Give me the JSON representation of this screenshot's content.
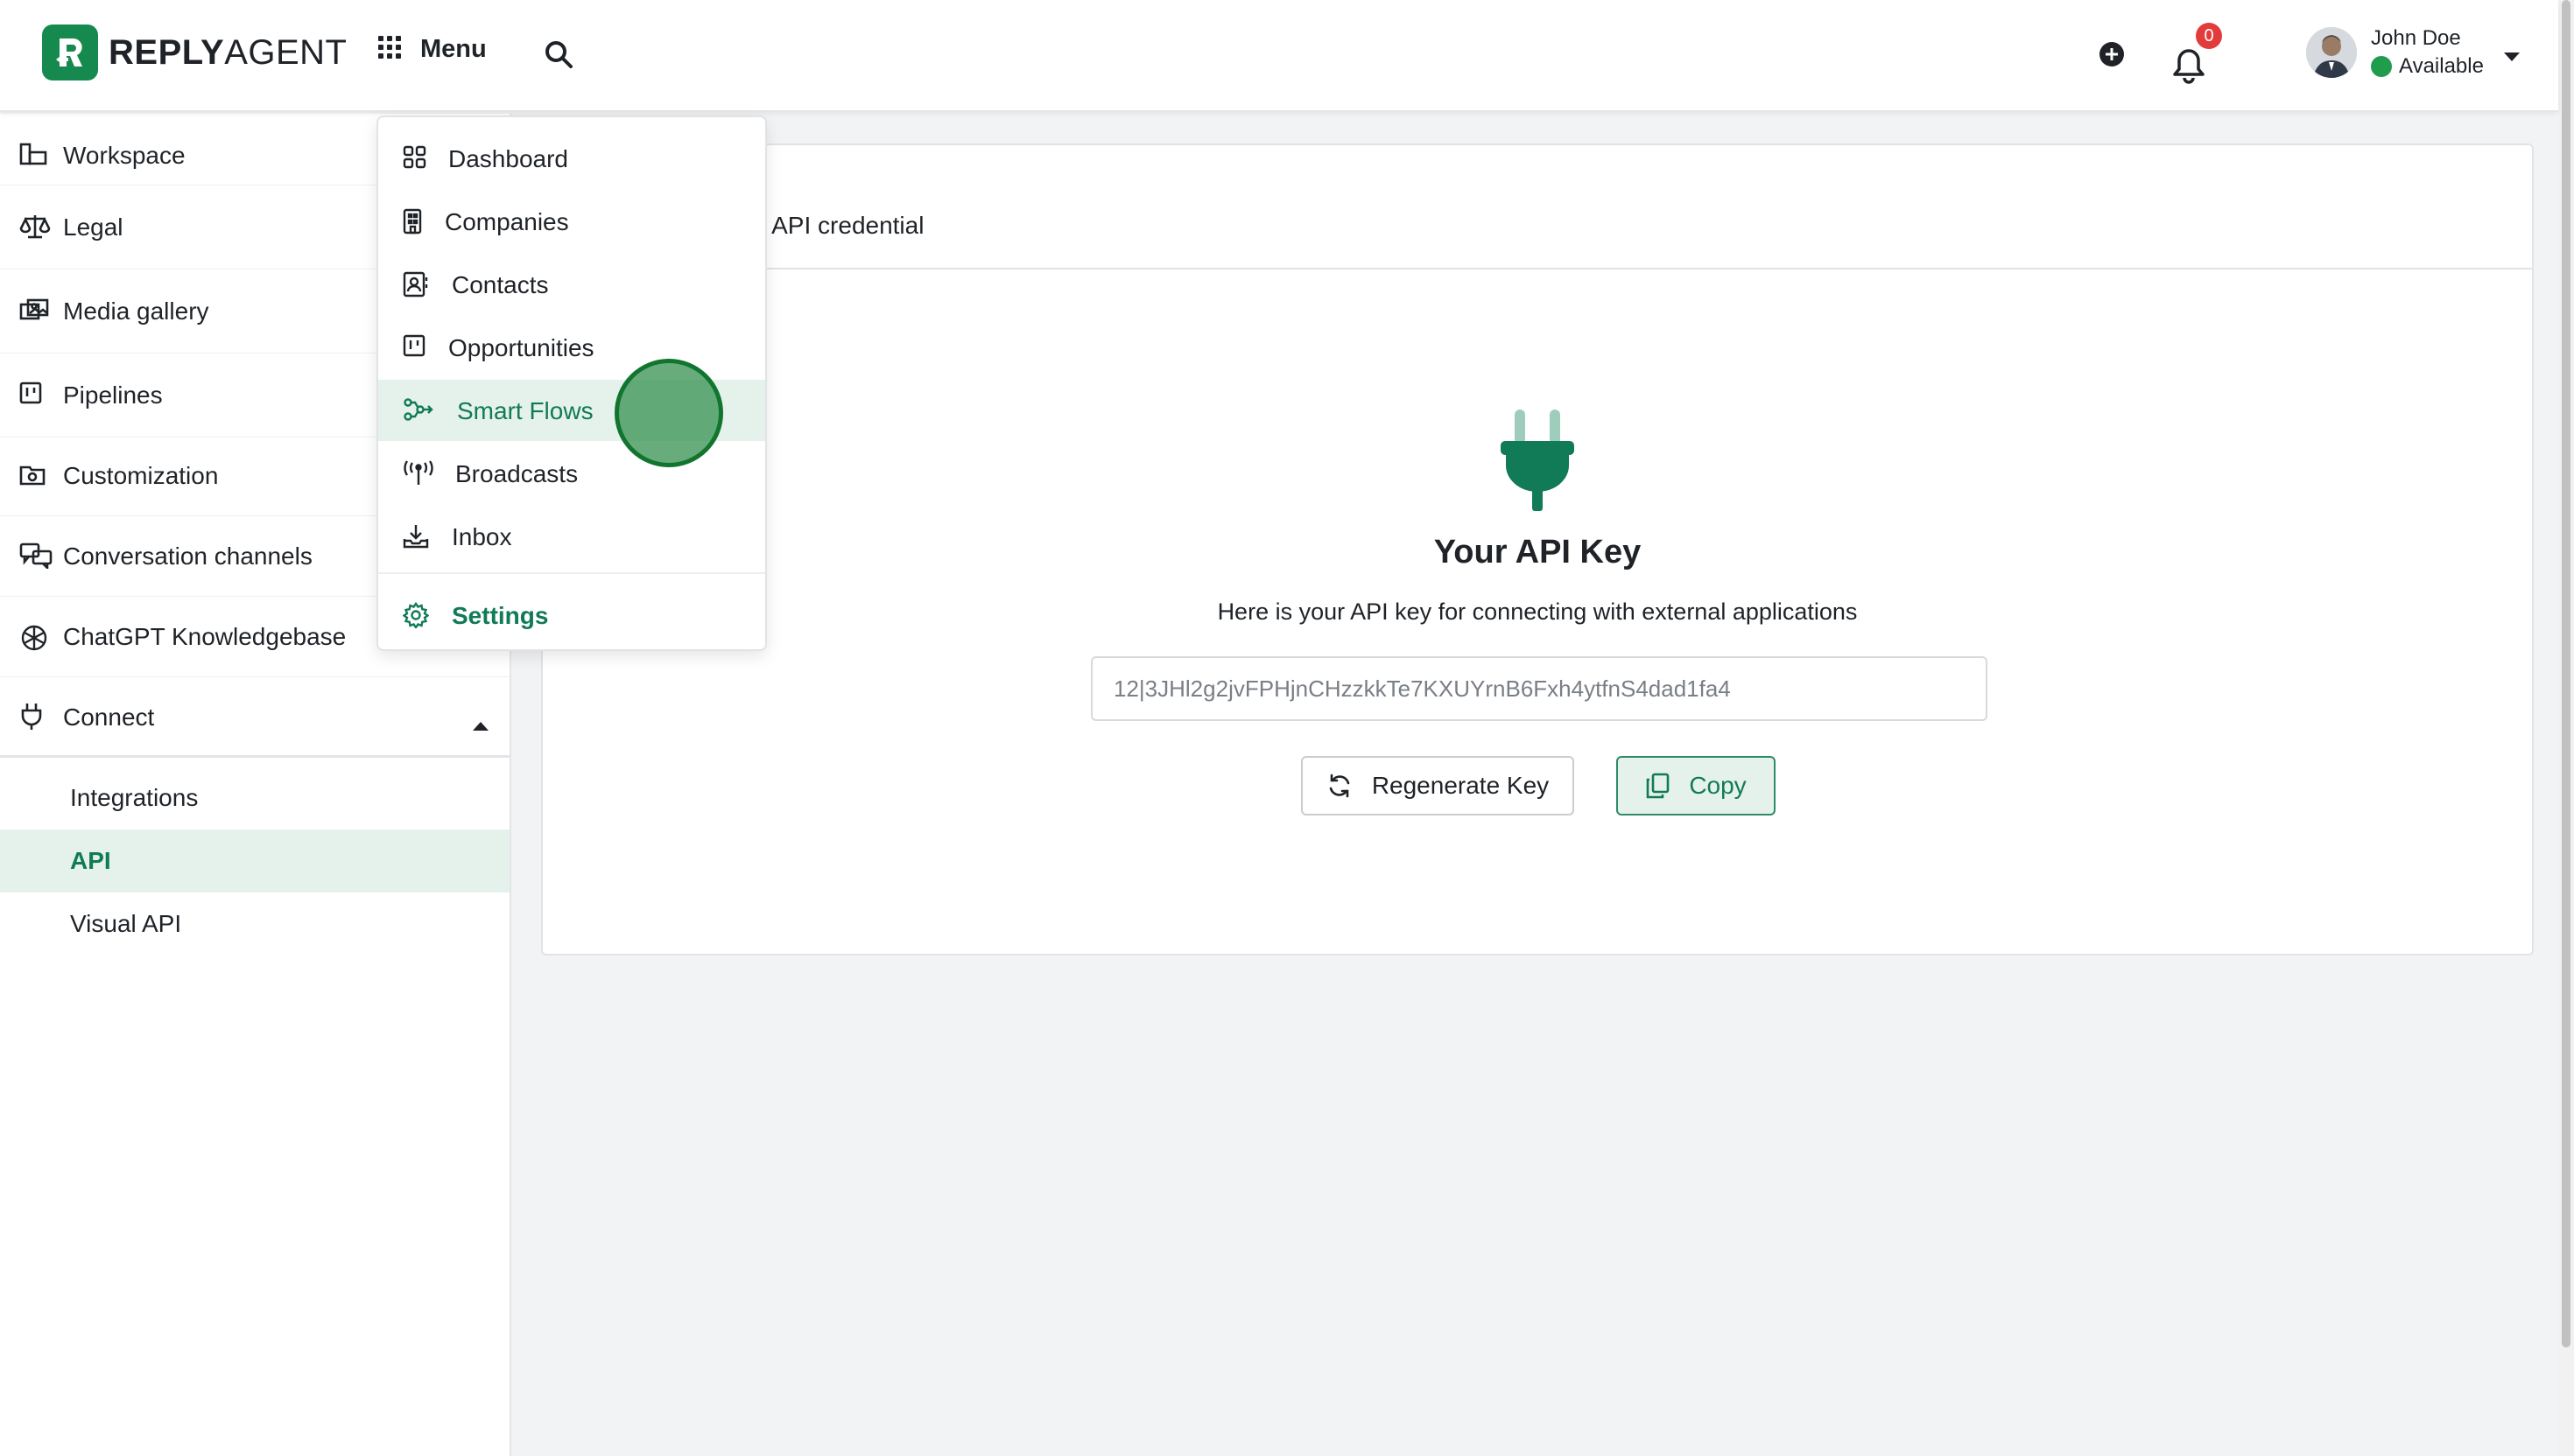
{
  "header": {
    "brand_bold": "REPLY",
    "brand_light": "AGENT",
    "menu_label": "Menu",
    "notification_count": "0",
    "user": {
      "name": "John Doe",
      "status": "Available"
    }
  },
  "sidebar": {
    "items": [
      {
        "label": "Workspace",
        "icon": "workspace-icon"
      },
      {
        "label": "Legal",
        "icon": "scale-icon"
      },
      {
        "label": "Media gallery",
        "icon": "media-icon"
      },
      {
        "label": "Pipelines",
        "icon": "pipeline-icon"
      },
      {
        "label": "Customization",
        "icon": "customization-icon"
      },
      {
        "label": "Conversation channels",
        "icon": "chat-icon"
      },
      {
        "label": "ChatGPT Knowledgebase",
        "icon": "openai-icon"
      },
      {
        "label": "Connect",
        "icon": "plug-icon"
      }
    ],
    "connect_sub": [
      {
        "label": "Integrations"
      },
      {
        "label": "API",
        "active": true
      },
      {
        "label": "Visual API"
      }
    ]
  },
  "dropdown": {
    "items": [
      {
        "label": "Dashboard",
        "icon": "dashboard-icon"
      },
      {
        "label": "Companies",
        "icon": "building-icon"
      },
      {
        "label": "Contacts",
        "icon": "contacts-icon"
      },
      {
        "label": "Opportunities",
        "icon": "opportunities-icon"
      },
      {
        "label": "Smart Flows",
        "icon": "flows-icon",
        "highlighted": true
      },
      {
        "label": "Broadcasts",
        "icon": "broadcast-icon"
      },
      {
        "label": "Inbox",
        "icon": "inbox-icon"
      }
    ],
    "settings_label": "Settings"
  },
  "content": {
    "subtitle": "ur API credential",
    "title": "Your API Key",
    "description": "Here is your API key for connecting with external applications",
    "api_key": "12|3JHl2g2jvFPHjnCHzzkkTe7KXUYrnB6Fxh4ytfnS4dad1fa4",
    "regenerate_label": "Regenerate Key",
    "copy_label": "Copy"
  },
  "colors": {
    "accent": "#117a57",
    "accent_bg": "#e5f2ec",
    "brand_green": "#168a4e",
    "badge_red": "#e23b3b"
  }
}
